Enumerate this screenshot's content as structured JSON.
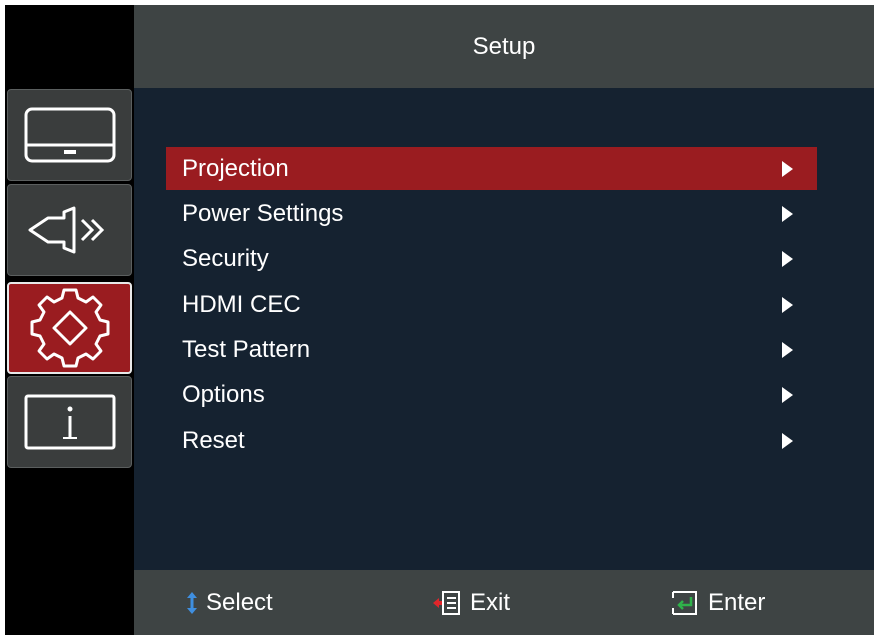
{
  "header": {
    "title": "Setup"
  },
  "sidebar": {
    "tabs": [
      {
        "name": "display",
        "icon": "monitor-icon",
        "active": false
      },
      {
        "name": "audio",
        "icon": "speaker-icon",
        "active": false
      },
      {
        "name": "setup",
        "icon": "gear-icon",
        "active": true
      },
      {
        "name": "information",
        "icon": "info-icon",
        "active": false
      }
    ]
  },
  "menu": {
    "items": [
      {
        "label": "Projection",
        "selected": true
      },
      {
        "label": "Power Settings",
        "selected": false
      },
      {
        "label": "Security",
        "selected": false
      },
      {
        "label": "HDMI CEC",
        "selected": false
      },
      {
        "label": "Test Pattern",
        "selected": false
      },
      {
        "label": "Options",
        "selected": false
      },
      {
        "label": "Reset",
        "selected": false
      }
    ]
  },
  "footer": {
    "select_label": "Select",
    "exit_label": "Exit",
    "enter_label": "Enter"
  },
  "colors": {
    "accent": "#9a1c20",
    "panel": "#3e4444",
    "background": "#152230",
    "select_icon": "#3f8fe0",
    "exit_icon": "#e0262b",
    "enter_icon": "#2fb24a"
  }
}
